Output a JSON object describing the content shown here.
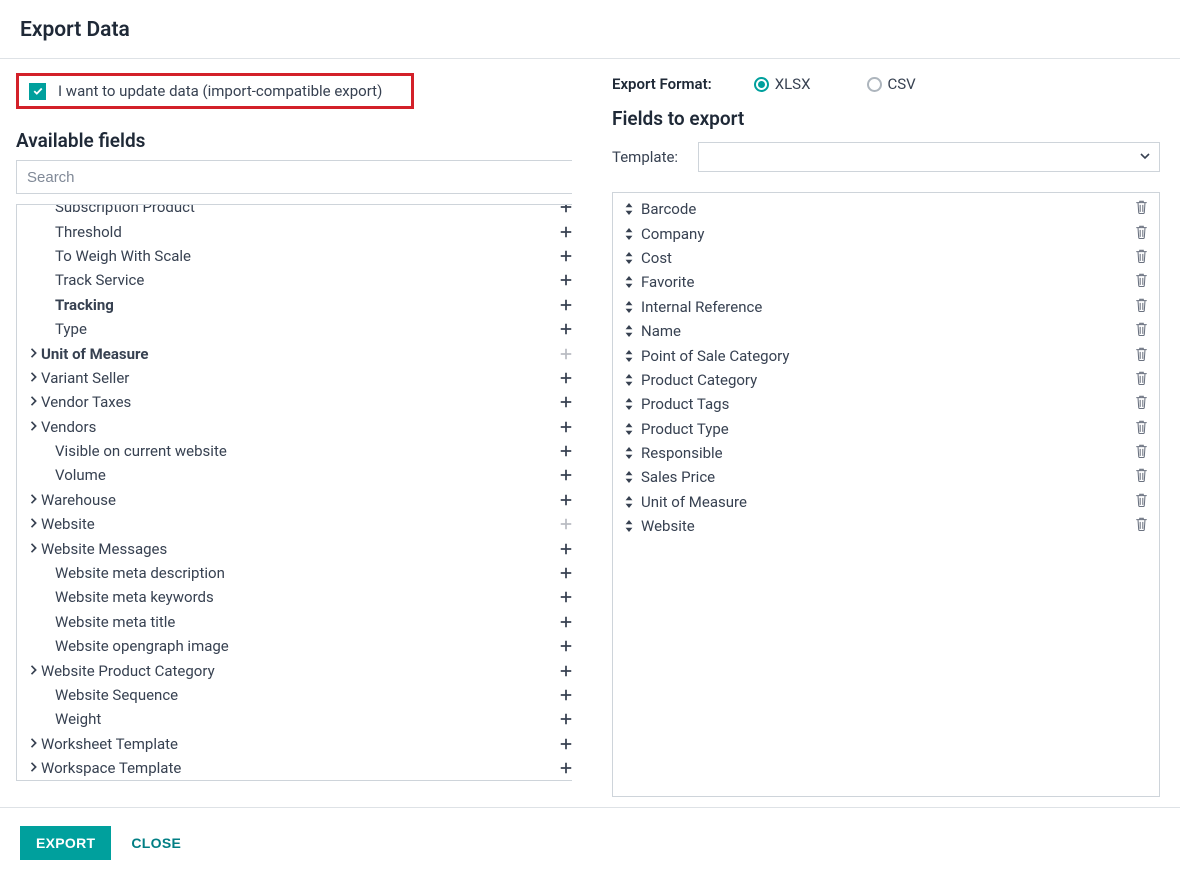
{
  "header": {
    "title": "Export Data"
  },
  "update_checkbox": {
    "checked": true,
    "label": "I want to update data (import-compatible export)"
  },
  "available": {
    "title": "Available fields",
    "search_placeholder": "Search",
    "items": [
      {
        "label": "Subscription Product",
        "indent": 2,
        "expand": false,
        "bold": false,
        "plus": true,
        "disabled": false
      },
      {
        "label": "Threshold",
        "indent": 2,
        "expand": false,
        "bold": false,
        "plus": true,
        "disabled": false
      },
      {
        "label": "To Weigh With Scale",
        "indent": 2,
        "expand": false,
        "bold": false,
        "plus": true,
        "disabled": false
      },
      {
        "label": "Track Service",
        "indent": 2,
        "expand": false,
        "bold": false,
        "plus": true,
        "disabled": false
      },
      {
        "label": "Tracking",
        "indent": 2,
        "expand": false,
        "bold": true,
        "plus": true,
        "disabled": false
      },
      {
        "label": "Type",
        "indent": 2,
        "expand": false,
        "bold": false,
        "plus": true,
        "disabled": false
      },
      {
        "label": "Unit of Measure",
        "indent": 1,
        "expand": true,
        "bold": true,
        "plus": true,
        "disabled": true
      },
      {
        "label": "Variant Seller",
        "indent": 1,
        "expand": true,
        "bold": false,
        "plus": true,
        "disabled": false
      },
      {
        "label": "Vendor Taxes",
        "indent": 1,
        "expand": true,
        "bold": false,
        "plus": true,
        "disabled": false
      },
      {
        "label": "Vendors",
        "indent": 1,
        "expand": true,
        "bold": false,
        "plus": true,
        "disabled": false
      },
      {
        "label": "Visible on current website",
        "indent": 2,
        "expand": false,
        "bold": false,
        "plus": true,
        "disabled": false
      },
      {
        "label": "Volume",
        "indent": 2,
        "expand": false,
        "bold": false,
        "plus": true,
        "disabled": false
      },
      {
        "label": "Warehouse",
        "indent": 1,
        "expand": true,
        "bold": false,
        "plus": true,
        "disabled": false
      },
      {
        "label": "Website",
        "indent": 1,
        "expand": true,
        "bold": false,
        "plus": true,
        "disabled": true
      },
      {
        "label": "Website Messages",
        "indent": 1,
        "expand": true,
        "bold": false,
        "plus": true,
        "disabled": false
      },
      {
        "label": "Website meta description",
        "indent": 2,
        "expand": false,
        "bold": false,
        "plus": true,
        "disabled": false
      },
      {
        "label": "Website meta keywords",
        "indent": 2,
        "expand": false,
        "bold": false,
        "plus": true,
        "disabled": false
      },
      {
        "label": "Website meta title",
        "indent": 2,
        "expand": false,
        "bold": false,
        "plus": true,
        "disabled": false
      },
      {
        "label": "Website opengraph image",
        "indent": 2,
        "expand": false,
        "bold": false,
        "plus": true,
        "disabled": false
      },
      {
        "label": "Website Product Category",
        "indent": 1,
        "expand": true,
        "bold": false,
        "plus": true,
        "disabled": false
      },
      {
        "label": "Website Sequence",
        "indent": 2,
        "expand": false,
        "bold": false,
        "plus": true,
        "disabled": false
      },
      {
        "label": "Weight",
        "indent": 2,
        "expand": false,
        "bold": false,
        "plus": true,
        "disabled": false
      },
      {
        "label": "Worksheet Template",
        "indent": 1,
        "expand": true,
        "bold": false,
        "plus": true,
        "disabled": false
      },
      {
        "label": "Workspace Template",
        "indent": 1,
        "expand": true,
        "bold": false,
        "plus": true,
        "disabled": false
      }
    ]
  },
  "export_format": {
    "label": "Export Format:",
    "options": [
      {
        "key": "xlsx",
        "label": "XLSX",
        "checked": true
      },
      {
        "key": "csv",
        "label": "CSV",
        "checked": false
      }
    ]
  },
  "fields_to_export": {
    "title": "Fields to export",
    "template_label": "Template:",
    "items": [
      {
        "label": "Barcode"
      },
      {
        "label": "Company"
      },
      {
        "label": "Cost"
      },
      {
        "label": "Favorite"
      },
      {
        "label": "Internal Reference"
      },
      {
        "label": "Name"
      },
      {
        "label": "Point of Sale Category"
      },
      {
        "label": "Product Category"
      },
      {
        "label": "Product Tags"
      },
      {
        "label": "Product Type"
      },
      {
        "label": "Responsible"
      },
      {
        "label": "Sales Price"
      },
      {
        "label": "Unit of Measure"
      },
      {
        "label": "Website"
      }
    ]
  },
  "footer": {
    "export": "EXPORT",
    "close": "CLOSE"
  },
  "colors": {
    "accent": "#00a09d",
    "highlight": "#d32029"
  }
}
